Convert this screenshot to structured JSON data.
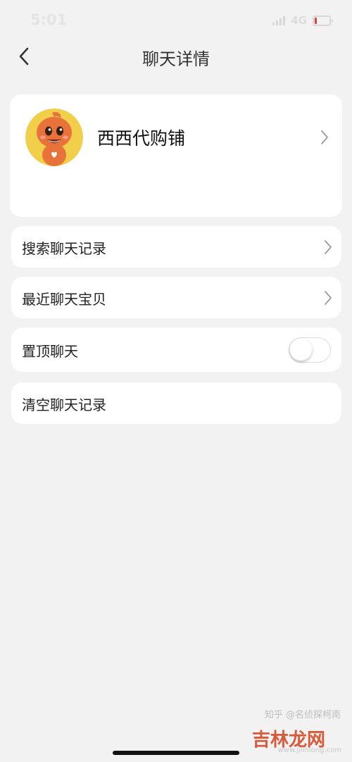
{
  "status_bar": {
    "time": "5:01",
    "network": "4G",
    "battery_level_percent": 10
  },
  "nav": {
    "title": "聊天详情"
  },
  "profile": {
    "shop_name": "西西代购铺"
  },
  "rows": {
    "search_history": "搜索聊天记录",
    "recent_items": "最近聊天宝贝",
    "pin_chat": "置顶聊天",
    "pin_chat_enabled": false,
    "clear_history": "清空聊天记录"
  },
  "watermarks": {
    "source": "知乎 @名侦探柯南",
    "site": "吉林龙网",
    "site_url": "www.jilinlong.com"
  },
  "colors": {
    "background": "#f2f2f2",
    "card": "#ffffff",
    "accent_orange": "#e8733a"
  },
  "icons": {
    "back": "chevron-left-icon",
    "row_arrow": "chevron-right-icon"
  }
}
